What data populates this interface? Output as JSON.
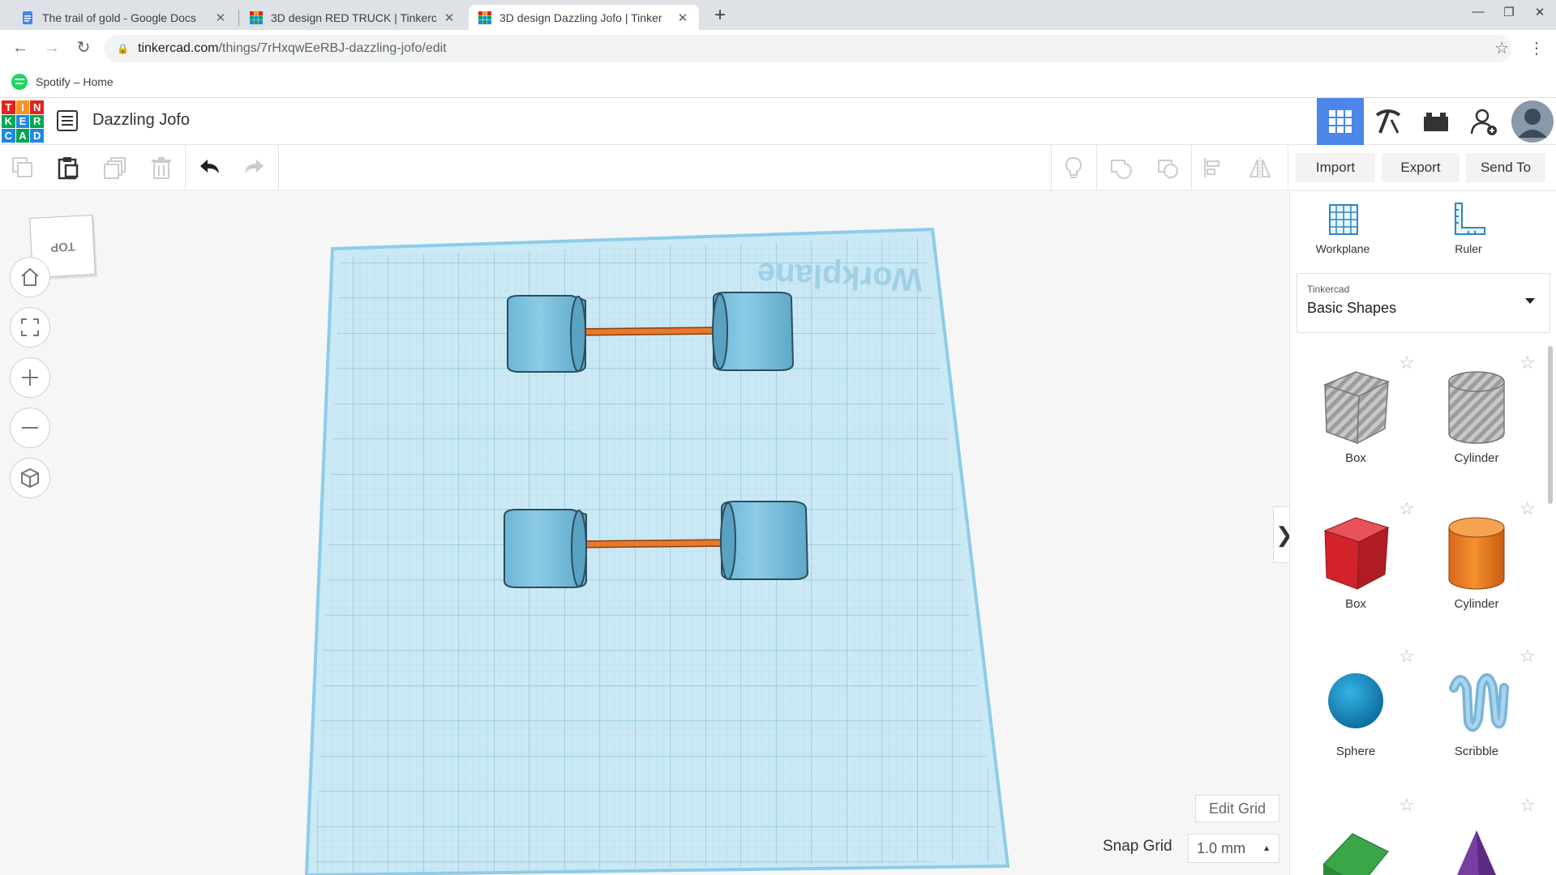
{
  "browser": {
    "tabs": [
      {
        "title": "The trail of gold - Google Docs",
        "active": false,
        "favicon": "docs-icon"
      },
      {
        "title": "3D design RED TRUCK | Tinkerca",
        "active": false,
        "favicon": "tinkercad-favicon"
      },
      {
        "title": "3D design Dazzling Jofo | Tinker",
        "active": true,
        "favicon": "tinkercad-favicon"
      }
    ],
    "url_host": "tinkercad.com",
    "url_path": "/things/7rHxqwEeRBJ-dazzling-jofo/edit",
    "bookmark": "Spotify – Home"
  },
  "app": {
    "logo_letters": [
      "T",
      "I",
      "N",
      "K",
      "E",
      "R",
      "C",
      "A",
      "D"
    ],
    "logo_colors": [
      "#e2231a",
      "#f7941d",
      "#e2231a",
      "#00a651",
      "#1e88e5",
      "#00a651",
      "#1e88e5",
      "#00a651",
      "#1e88e5"
    ],
    "design_name": "Dazzling Jofo",
    "accent": "#4b86e8"
  },
  "toolbar": {
    "import_label": "Import",
    "export_label": "Export",
    "send_label": "Send To"
  },
  "canvas": {
    "viewcube_label": "TOP",
    "workplane_label": "Workplane",
    "edit_grid_label": "Edit Grid",
    "snap_grid_label": "Snap Grid",
    "snap_grid_value": "1.0 mm",
    "wheel_color": "#7ec3e0",
    "axle_color": "#e8792b"
  },
  "panel": {
    "workplane_label": "Workplane",
    "ruler_label": "Ruler",
    "library_source": "Tinkercad",
    "library_name": "Basic Shapes",
    "shapes": [
      {
        "label": "Box",
        "icon": "box-hole-icon"
      },
      {
        "label": "Cylinder",
        "icon": "cylinder-hole-icon"
      },
      {
        "label": "Box",
        "icon": "box-red-icon"
      },
      {
        "label": "Cylinder",
        "icon": "cylinder-orange-icon"
      },
      {
        "label": "Sphere",
        "icon": "sphere-icon"
      },
      {
        "label": "Scribble",
        "icon": "scribble-icon"
      }
    ]
  }
}
